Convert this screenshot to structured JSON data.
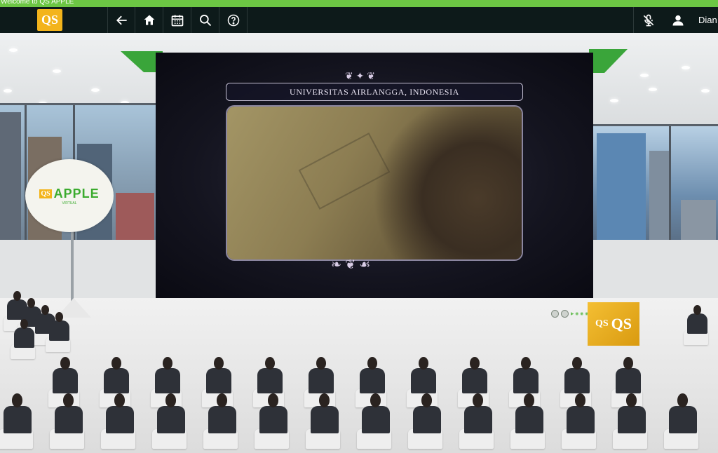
{
  "titlebar": {
    "text": "Welcome to QS APPLE"
  },
  "navbar": {
    "logo_text": "QS",
    "buttons": [
      {
        "name": "back-button",
        "icon": "arrow-left-icon"
      },
      {
        "name": "home-button",
        "icon": "home-icon"
      },
      {
        "name": "calendar-button",
        "icon": "calendar-icon"
      },
      {
        "name": "search-button",
        "icon": "search-icon"
      },
      {
        "name": "help-button",
        "icon": "help-circle-icon"
      }
    ],
    "mute_icon": "microphone-off-icon",
    "profile_icon": "user-icon",
    "username": "Dian"
  },
  "scene": {
    "stage_banner": "UNIVERSITAS AIRLANGGA, INDONESIA",
    "sign": {
      "logo": "QS",
      "text": "APPLE",
      "subtitle": "VIRTUAL"
    },
    "box": {
      "left": "QS",
      "right": "QS"
    },
    "video_controls_text": "▶ ◉ ◉ ◉"
  },
  "colors": {
    "titlebar": "#6cc644",
    "navbar": "#0d1a1a",
    "qs_yellow": "#f3b41b",
    "apple_green": "#3bab2e"
  }
}
